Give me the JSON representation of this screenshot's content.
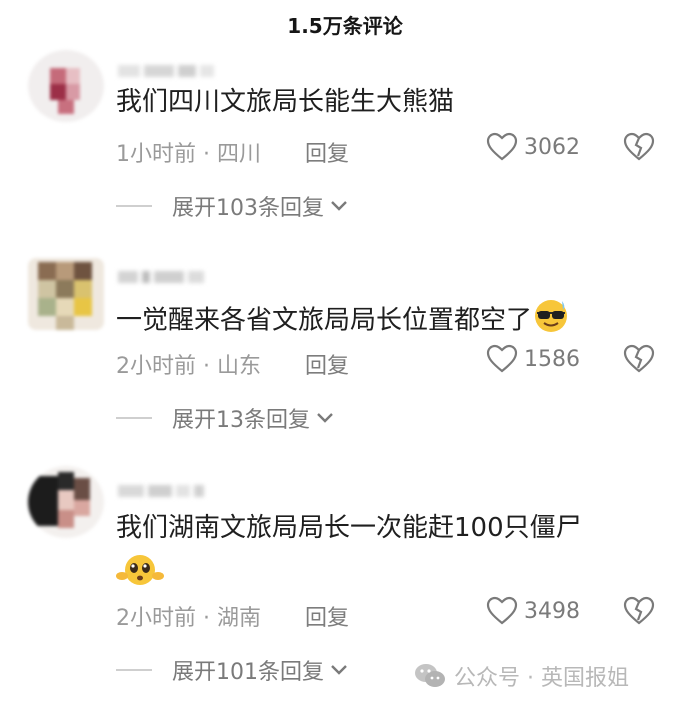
{
  "header": {
    "title": "1.5万条评论"
  },
  "comments": [
    {
      "text": "我们四川文旅局长能生大熊猫",
      "time": "1小时前 · 四川",
      "reply_label": "回复",
      "likes": "3062",
      "expand_label": "展开103条回复"
    },
    {
      "text": "一觉醒来各省文旅局局长位置都空了",
      "emoji": "sunglasses-face",
      "time": "2小时前 · 山东",
      "reply_label": "回复",
      "likes": "1586",
      "expand_label": "展开13条回复"
    },
    {
      "text": "我们湖南文旅局局长一次能赶100只僵尸",
      "emoji": "pleading-face",
      "time": "2小时前 · 湖南",
      "reply_label": "回复",
      "likes": "3498",
      "expand_label": "展开101条回复"
    }
  ],
  "watermark": {
    "text": "公众号 · 英国报姐"
  },
  "colors": {
    "text": "#1f1f1f",
    "meta": "#9a9a9a",
    "background": "#ffffff"
  }
}
